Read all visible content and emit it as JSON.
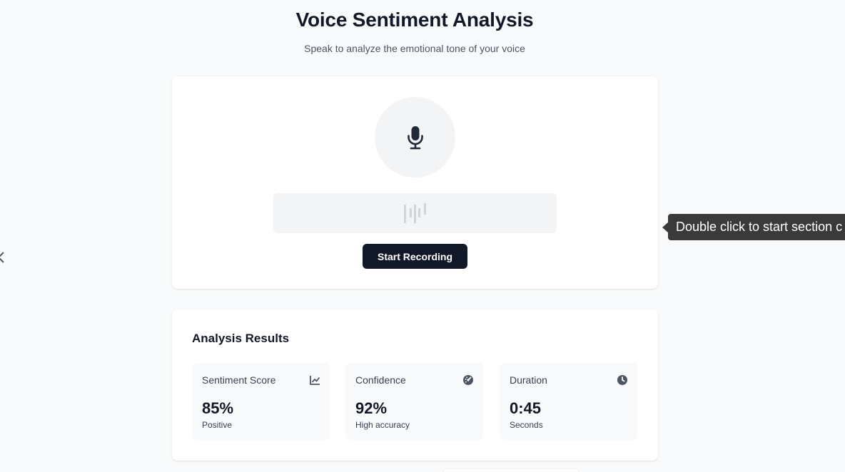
{
  "header": {
    "title": "Voice Sentiment Analysis",
    "subtitle": "Speak to analyze the emotional tone of your voice"
  },
  "recorder": {
    "mic_icon": "microphone-icon",
    "waveform_icon": "waveform-icon",
    "button_label": "Start Recording"
  },
  "results": {
    "title": "Analysis Results",
    "stats": [
      {
        "label": "Sentiment Score",
        "value": "85%",
        "sub": "Positive",
        "icon": "chart-line-icon"
      },
      {
        "label": "Confidence",
        "value": "92%",
        "sub": "High accuracy",
        "icon": "gauge-icon"
      },
      {
        "label": "Duration",
        "value": "0:45",
        "sub": "Seconds",
        "icon": "clock-icon"
      }
    ]
  },
  "tooltip": {
    "text": "Double click to start section c"
  },
  "colors": {
    "background": "#f9fafb",
    "card": "#ffffff",
    "primary_button": "#111827",
    "text_primary": "#111827",
    "text_secondary": "#4b5563",
    "tooltip": "#3a3a3a"
  }
}
